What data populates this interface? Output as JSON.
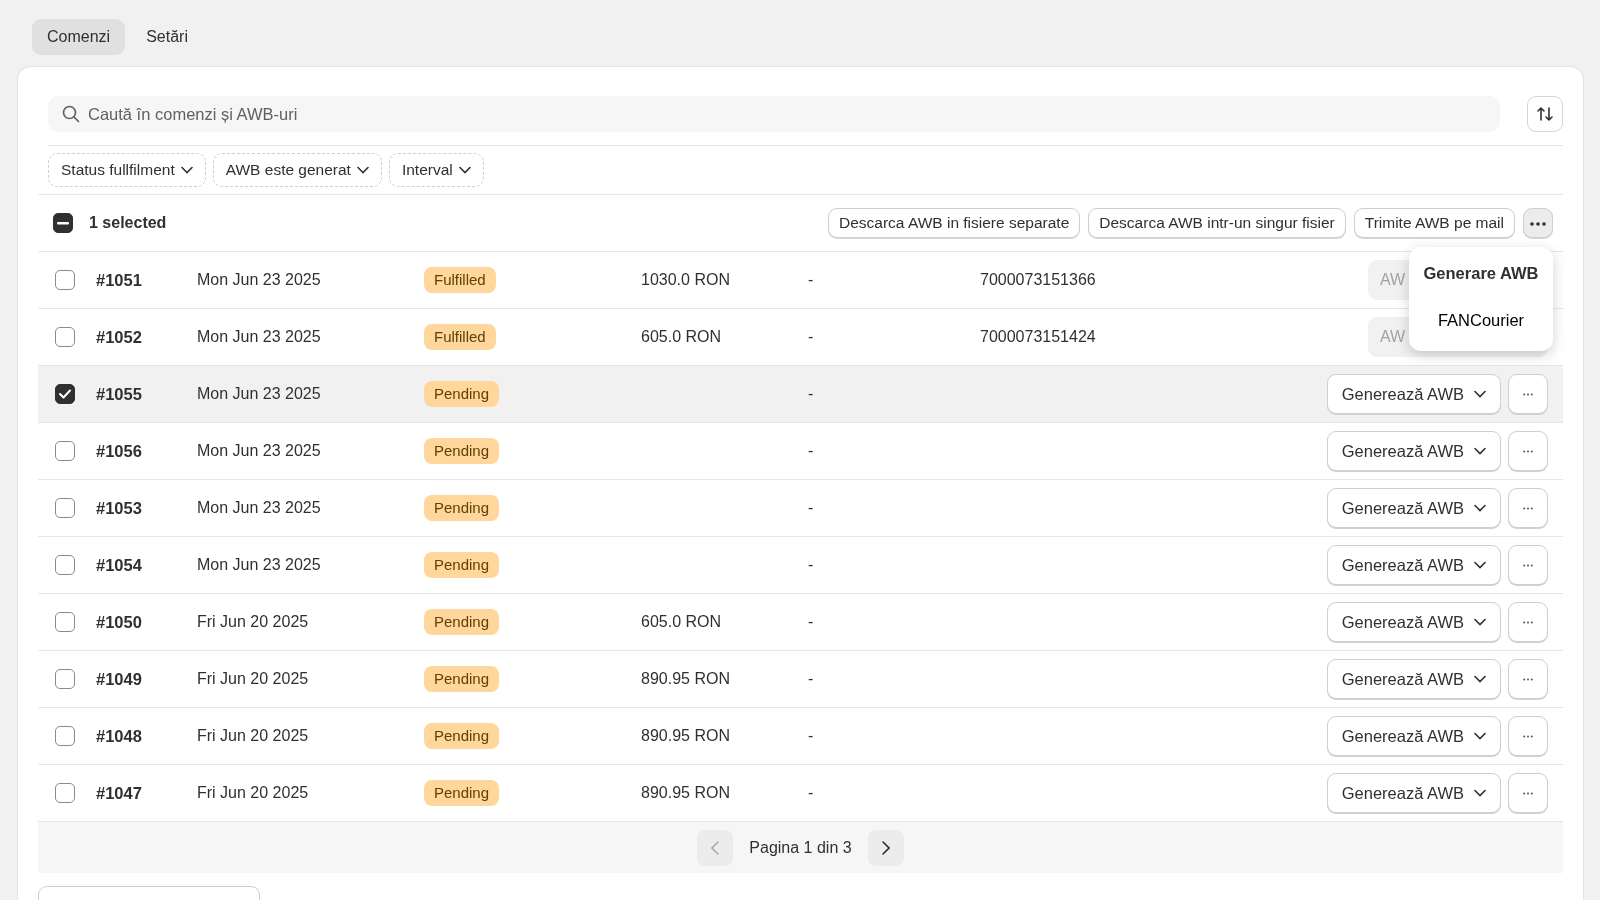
{
  "tabs": [
    {
      "label": "Comenzi",
      "selected": true
    },
    {
      "label": "Setări",
      "selected": false
    }
  ],
  "search": {
    "placeholder": "Caută în comenzi și AWB-uri"
  },
  "filters": [
    "Status fullfilment",
    "AWB este generat",
    "Interval"
  ],
  "bulk": {
    "checked": true,
    "indeterminate": true,
    "selection": "1 selected",
    "actions": [
      "Descarca AWB in fisiere separate",
      "Descarca AWB intr-un singur fisier",
      "Trimite AWB pe mail"
    ]
  },
  "menu": {
    "title": "Generare AWB",
    "items": [
      "FANCourier"
    ]
  },
  "orders": [
    {
      "selected": false,
      "number": "#1051",
      "date": "Mon Jun 23 2025",
      "status": "Fulfilled",
      "amount": "1030.0 RON",
      "column_5": "-",
      "awb": "7000073151366",
      "action": {
        "kind": "disabled",
        "label": "AW"
      }
    },
    {
      "selected": false,
      "number": "#1052",
      "date": "Mon Jun 23 2025",
      "status": "Fulfilled",
      "amount": "605.0 RON",
      "column_5": "-",
      "awb": "7000073151424",
      "action": {
        "kind": "disabled",
        "label": "AW"
      }
    },
    {
      "selected": true,
      "number": "#1055",
      "date": "Mon Jun 23 2025",
      "status": "Pending",
      "column_5": "-",
      "action": {
        "kind": "dropdown",
        "label": "Generează AWB"
      }
    },
    {
      "selected": false,
      "number": "#1056",
      "date": "Mon Jun 23 2025",
      "status": "Pending",
      "column_5": "-",
      "action": {
        "kind": "dropdown",
        "label": "Generează AWB"
      }
    },
    {
      "selected": false,
      "number": "#1053",
      "date": "Mon Jun 23 2025",
      "status": "Pending",
      "column_5": "-",
      "action": {
        "kind": "dropdown",
        "label": "Generează AWB"
      }
    },
    {
      "selected": false,
      "number": "#1054",
      "date": "Mon Jun 23 2025",
      "status": "Pending",
      "column_5": "-",
      "action": {
        "kind": "dropdown",
        "label": "Generează AWB"
      }
    },
    {
      "selected": false,
      "number": "#1050",
      "date": "Fri Jun 20 2025",
      "status": "Pending",
      "amount": "605.0 RON",
      "column_5": "-",
      "action": {
        "kind": "dropdown",
        "label": "Generează AWB"
      }
    },
    {
      "selected": false,
      "number": "#1049",
      "date": "Fri Jun 20 2025",
      "status": "Pending",
      "amount": "890.95 RON",
      "column_5": "-",
      "action": {
        "kind": "dropdown",
        "label": "Generează AWB"
      }
    },
    {
      "selected": false,
      "number": "#1048",
      "date": "Fri Jun 20 2025",
      "status": "Pending",
      "amount": "890.95 RON",
      "column_5": "-",
      "action": {
        "kind": "dropdown",
        "label": "Generează AWB"
      }
    },
    {
      "selected": false,
      "number": "#1047",
      "date": "Fri Jun 20 2025",
      "status": "Pending",
      "amount": "890.95 RON",
      "column_5": "-",
      "action": {
        "kind": "dropdown",
        "label": "Generează AWB"
      }
    }
  ],
  "pagination": {
    "label": "Pagina 1 din 3",
    "previous_disabled": true
  }
}
